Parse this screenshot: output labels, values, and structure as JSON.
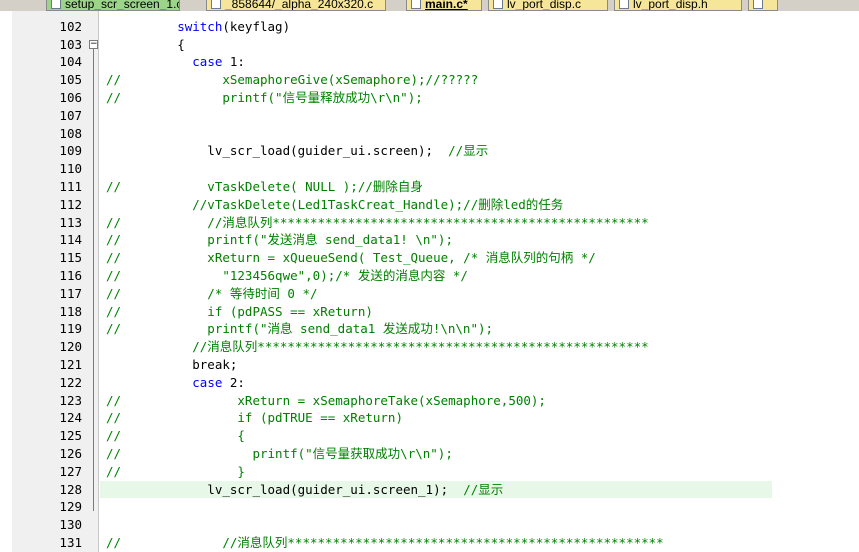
{
  "tabs": [
    {
      "label": "setup_scr_screen_1.c",
      "style": "green"
    },
    {
      "label": "_858644/_alpha_240x320.c",
      "style": "yellow"
    },
    {
      "label": "main.c*",
      "style": "active"
    },
    {
      "label": "lv_port_disp.c",
      "style": "yellow"
    },
    {
      "label": "lv_port_disp.h",
      "style": "yellow"
    },
    {
      "label": "",
      "style": "yellow"
    }
  ],
  "lines": [
    {
      "n": "102",
      "prefix": "",
      "segs": [
        {
          "t": "        switch",
          "c": "kw"
        },
        {
          "t": "(keyflag)"
        }
      ]
    },
    {
      "n": "103",
      "prefix": "",
      "fold": "−",
      "segs": [
        {
          "t": "        {"
        }
      ]
    },
    {
      "n": "104",
      "prefix": "",
      "segs": [
        {
          "t": "          "
        },
        {
          "t": "case",
          "c": "kw"
        },
        {
          "t": " 1:"
        }
      ]
    },
    {
      "n": "105",
      "prefix": "//",
      "segs": [
        {
          "t": "              xSemaphoreGive(xSemaphore);//?????",
          "c": "cm"
        }
      ]
    },
    {
      "n": "106",
      "prefix": "//",
      "segs": [
        {
          "t": "              printf(\"信号量释放成功\\r\\n\");",
          "c": "cm"
        }
      ]
    },
    {
      "n": "107",
      "prefix": "",
      "segs": []
    },
    {
      "n": "108",
      "prefix": "",
      "segs": []
    },
    {
      "n": "109",
      "prefix": "",
      "segs": [
        {
          "t": "            lv_scr_load(guider_ui.screen);  "
        },
        {
          "t": "//显示",
          "c": "cm"
        }
      ]
    },
    {
      "n": "110",
      "prefix": "",
      "segs": []
    },
    {
      "n": "111",
      "prefix": "//",
      "segs": [
        {
          "t": "            vTaskDelete( NULL );//删除自身",
          "c": "cm"
        }
      ]
    },
    {
      "n": "112",
      "prefix": "",
      "segs": [
        {
          "t": "          //vTaskDelete(Led1TaskCreat_Handle);//删除led的任务",
          "c": "cm"
        }
      ]
    },
    {
      "n": "113",
      "prefix": "//",
      "segs": [
        {
          "t": "            //消息队列**************************************************",
          "c": "cm"
        }
      ]
    },
    {
      "n": "114",
      "prefix": "//",
      "segs": [
        {
          "t": "            printf(\"发送消息 send_data1! \\n\");",
          "c": "cm"
        }
      ]
    },
    {
      "n": "115",
      "prefix": "//",
      "segs": [
        {
          "t": "            xReturn = xQueueSend( Test_Queue, /* 消息队列的句柄 */",
          "c": "cm"
        }
      ]
    },
    {
      "n": "116",
      "prefix": "//",
      "segs": [
        {
          "t": "              \"123456qwe\",0);/* 发送的消息内容 */",
          "c": "cm"
        }
      ]
    },
    {
      "n": "117",
      "prefix": "//",
      "segs": [
        {
          "t": "            /* 等待时间 0 */",
          "c": "cm"
        }
      ]
    },
    {
      "n": "118",
      "prefix": "//",
      "segs": [
        {
          "t": "            if (pdPASS == xReturn)",
          "c": "cm"
        }
      ]
    },
    {
      "n": "119",
      "prefix": "//",
      "segs": [
        {
          "t": "            printf(\"消息 send_data1 发送成功!\\n\\n\");",
          "c": "cm"
        }
      ]
    },
    {
      "n": "120",
      "prefix": "",
      "segs": [
        {
          "t": "          //消息队列****************************************************",
          "c": "cm"
        }
      ]
    },
    {
      "n": "121",
      "prefix": "",
      "segs": [
        {
          "t": "          break;"
        }
      ]
    },
    {
      "n": "122",
      "prefix": "",
      "segs": [
        {
          "t": "          "
        },
        {
          "t": "case",
          "c": "kw"
        },
        {
          "t": " 2:"
        }
      ]
    },
    {
      "n": "123",
      "prefix": "//",
      "segs": [
        {
          "t": "                xReturn = xSemaphoreTake(xSemaphore,500);",
          "c": "cm"
        }
      ]
    },
    {
      "n": "124",
      "prefix": "//",
      "segs": [
        {
          "t": "                if (pdTRUE == xReturn)",
          "c": "cm"
        }
      ]
    },
    {
      "n": "125",
      "prefix": "//",
      "segs": [
        {
          "t": "                {",
          "c": "cm"
        }
      ]
    },
    {
      "n": "126",
      "prefix": "//",
      "segs": [
        {
          "t": "                  printf(\"信号量获取成功\\r\\n\");",
          "c": "cm"
        }
      ]
    },
    {
      "n": "127",
      "prefix": "//",
      "segs": [
        {
          "t": "                }",
          "c": "cm"
        }
      ]
    },
    {
      "n": "128",
      "prefix": "",
      "highlight": true,
      "segs": [
        {
          "t": "            lv_scr_load(guider_ui.screen_1);  "
        },
        {
          "t": "//显示",
          "c": "cm"
        }
      ]
    },
    {
      "n": "129",
      "prefix": "",
      "segs": []
    },
    {
      "n": "130",
      "prefix": "",
      "segs": []
    },
    {
      "n": "131",
      "prefix": "//",
      "segs": [
        {
          "t": "              //消息队列**************************************************",
          "c": "cm"
        }
      ]
    }
  ]
}
